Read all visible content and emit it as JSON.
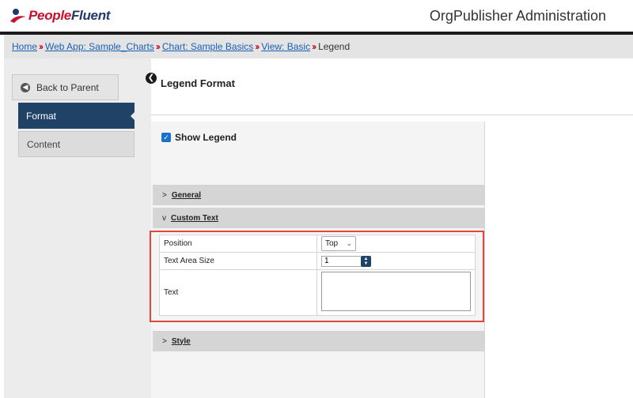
{
  "header": {
    "logo_part1": "People",
    "logo_part2": "Fluent",
    "app_title": "OrgPublisher Administration"
  },
  "breadcrumb": {
    "items": [
      "Home",
      "Web App: Sample_Charts",
      "Chart: Sample Basics",
      "View: Basic"
    ],
    "separator": "››",
    "current": "Legend"
  },
  "sidebar": {
    "back_label": "Back to Parent",
    "items": [
      {
        "label": "Format",
        "active": true
      },
      {
        "label": "Content",
        "active": false
      }
    ]
  },
  "main": {
    "title": "Legend Format",
    "show_legend": {
      "label": "Show Legend",
      "checked": true
    },
    "sections": {
      "general": {
        "label": "General",
        "chevron": ">"
      },
      "custom_text": {
        "label": "Custom Text",
        "chevron": "v"
      },
      "style": {
        "label": "Style",
        "chevron": ">"
      }
    },
    "custom_text_props": {
      "position_label": "Position",
      "position_value": "Top",
      "text_area_size_label": "Text Area Size",
      "text_area_size_value": "1",
      "text_label": "Text",
      "text_value": ""
    }
  },
  "colors": {
    "accent_navy": "#1f4266",
    "brand_red": "#c8102e",
    "link_blue": "#1a5fb4",
    "highlight_red": "#e0463a",
    "checkbox_blue": "#1a73c8"
  }
}
